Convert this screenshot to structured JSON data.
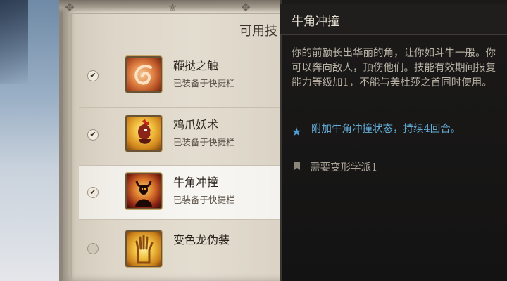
{
  "panel": {
    "title": "可用技"
  },
  "abilities": [
    {
      "name": "鞭挞之触",
      "status": "已装备于快捷栏",
      "equipped": true,
      "icon": "lash-touch-icon",
      "color": "#e07a3a"
    },
    {
      "name": "鸡爪妖术",
      "status": "已装备于快捷栏",
      "equipped": true,
      "icon": "chicken-claw-icon",
      "color": "#e9b640"
    },
    {
      "name": "牛角冲撞",
      "status": "已装备于快捷栏",
      "equipped": true,
      "icon": "bull-rush-icon",
      "color": "#c9462a"
    },
    {
      "name": "变色龙伪装",
      "status": "",
      "equipped": false,
      "icon": "chameleon-cloak-icon",
      "color": "#f0c040"
    }
  ],
  "tooltip": {
    "title": "牛角冲撞",
    "description": "你的前额长出华丽的角，让你如斗牛一般。你可以奔向敌人，顶伤他们。技能有效期间报复能力等级加1，不能与美杜莎之首同时使用。",
    "bonus": "附加牛角冲撞状态，持续4回合。",
    "requirement": "需要变形学派1",
    "colors": {
      "bonus": "#63acd8",
      "text": "#b9b1a4"
    }
  }
}
